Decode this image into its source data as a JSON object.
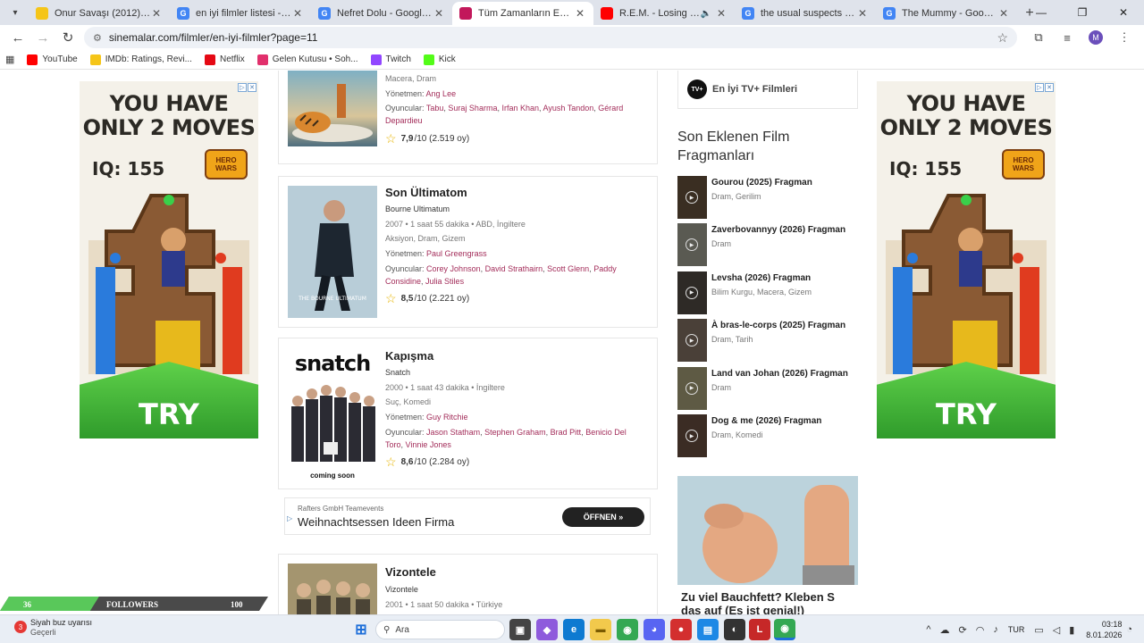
{
  "browser": {
    "tabs": [
      {
        "title": "Onur Savaşı (2012) - IMDb",
        "fav_color": "#f5c518",
        "fav_text": "",
        "active": false,
        "muted": false
      },
      {
        "title": "en iyi filmler listesi - Google'da Ara",
        "fav_color": "#4285f4",
        "fav_text": "G",
        "active": false,
        "muted": false
      },
      {
        "title": "Nefret Dolu - Google'da Ara",
        "fav_color": "#4285f4",
        "fav_text": "G",
        "active": false,
        "muted": false
      },
      {
        "title": "Tüm Zamanların En İyi Filmleri",
        "fav_color": "#c2185b",
        "fav_text": "",
        "active": true,
        "muted": false
      },
      {
        "title": "R.E.M. - Losing My Religion",
        "fav_color": "#ff0000",
        "fav_text": "",
        "active": false,
        "muted": true
      },
      {
        "title": "the usual suspects - Google'da Ara",
        "fav_color": "#4285f4",
        "fav_text": "G",
        "active": false,
        "muted": false
      },
      {
        "title": "The Mummy - Google'da Ara",
        "fav_color": "#4285f4",
        "fav_text": "G",
        "active": false,
        "muted": false
      }
    ],
    "url": "sinemalar.com/filmler/en-iyi-filmler?page=11",
    "profile_initial": "M",
    "bookmarks": [
      {
        "label": "YouTube",
        "color": "#ff0000"
      },
      {
        "label": "IMDb: Ratings, Revi...",
        "color": "#f5c518"
      },
      {
        "label": "Netflix",
        "color": "#e50914"
      },
      {
        "label": "Gelen Kutusu • Soh...",
        "color": "#e1306c"
      },
      {
        "label": "Twitch",
        "color": "#9146ff"
      },
      {
        "label": "Kick",
        "color": "#53fc18"
      }
    ]
  },
  "ads": {
    "side_headline_1": "YOU HAVE",
    "side_headline_2": "ONLY 2 MOVES",
    "side_iq": "IQ: 155",
    "side_logo": "HERO WARS",
    "side_cta": "TRY",
    "inline_advertiser": "Rafters GmbH Teamevents",
    "inline_title": "Weihnachtsessen Ideen Firma",
    "inline_button": "ÖFFNEN"
  },
  "movies": [
    {
      "title": "",
      "original": "",
      "meta": "",
      "genres": "Macera, Dram",
      "director_label": "Yönetmen:",
      "director": "Ang Lee",
      "cast_label": "Oyuncular:",
      "cast": [
        "Tabu",
        "Suraj Sharma",
        "Irfan Khan",
        "Ayush Tandon",
        "Gérard Depardieu"
      ],
      "rating": "7,9",
      "rating_suffix": "/10 (2.519 oy)"
    },
    {
      "title": "Son Ültimatom",
      "original": "Bourne Ultimatum",
      "meta": "2007 • 1 saat 55 dakika • ABD, İngiltere",
      "genres": "Aksiyon, Dram, Gizem",
      "director_label": "Yönetmen:",
      "director": "Paul Greengrass",
      "cast_label": "Oyuncular:",
      "cast": [
        "Corey Johnson",
        "David Strathairn",
        "Scott Glenn",
        "Paddy Considine",
        "Julia Stiles"
      ],
      "rating": "8,5",
      "rating_suffix": "/10 (2.221 oy)"
    },
    {
      "title": "Kapışma",
      "original": "Snatch",
      "meta": "2000 • 1 saat 43 dakika • İngiltere",
      "genres": "Suç, Komedi",
      "director_label": "Yönetmen:",
      "director": "Guy Ritchie",
      "cast_label": "Oyuncular:",
      "cast": [
        "Jason Statham",
        "Stephen Graham",
        "Brad Pitt",
        "Benicio Del Toro",
        "Vinnie Jones"
      ],
      "rating": "8,6",
      "rating_suffix": "/10 (2.284 oy)",
      "poster_word": "snatch",
      "poster_footer": "coming soon"
    },
    {
      "title": "Vizontele",
      "original": "Vizontele",
      "meta": "2001 • 1 saat 50 dakika • Türkiye"
    }
  ],
  "sidebar": {
    "tvplus_label": "En İyi TV+ Filmleri",
    "tvplus_icon": "TV+",
    "trailers_heading": "Son Eklenen Film Fragmanları",
    "trailers": [
      {
        "title": "Gourou (2025) Fragman",
        "genres": "Dram, Gerilim"
      },
      {
        "title": "Zaverbovannyy (2026) Fragman",
        "genres": "Dram"
      },
      {
        "title": "Levsha (2026) Fragman",
        "genres": "Bilim Kurgu, Macera, Gizem"
      },
      {
        "title": "À bras-le-corps (2025) Fragman",
        "genres": "Dram, Tarih"
      },
      {
        "title": "Land van Johan (2026) Fragman",
        "genres": "Dram"
      },
      {
        "title": "Dog & me (2026) Fragman",
        "genres": "Dram, Komedi"
      }
    ],
    "ad_caption_1": "Zu viel Bauchfett? Kleben S",
    "ad_caption_2": "das auf (Es ist genial!)"
  },
  "followers_bar": {
    "count": "36",
    "label": "FOLLOWERS",
    "goal": "100",
    "progress": 0.36
  },
  "taskbar": {
    "weather_title": "Siyah buz uyarısı",
    "weather_sub": "Geçerli",
    "weather_badge": "3",
    "search_placeholder": "Ara",
    "lang": "TUR",
    "time": "03:18",
    "date": "8.01.2026"
  }
}
